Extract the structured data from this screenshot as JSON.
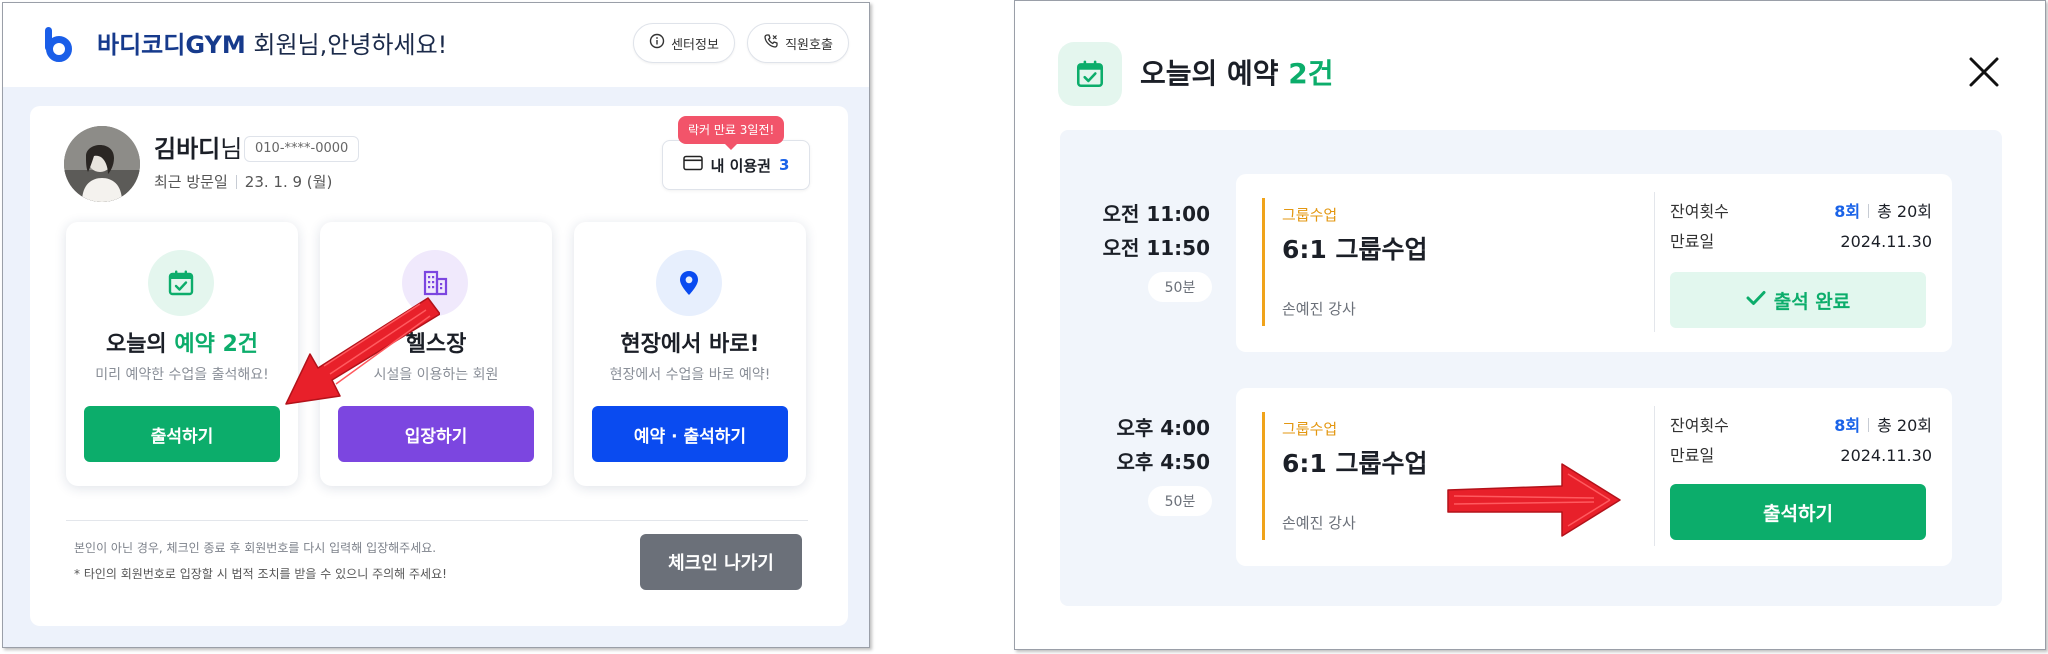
{
  "left": {
    "header": {
      "brand": "바디코디GYM",
      "greeting": " 회원님,안녕하세요!",
      "center_info_label": "센터정보",
      "staff_call_label": "직원호출"
    },
    "member": {
      "name": "김바디",
      "name_suffix": "님",
      "phone": "010-****-0000",
      "last_visit_label": "최근 방문일",
      "last_visit_value": "23. 1. 9 (월)"
    },
    "pass": {
      "badge": "락커 만료 3일전!",
      "label": "내 이용권",
      "count": "3"
    },
    "cards": [
      {
        "title_a": "오늘의 ",
        "title_b": "예약 2건",
        "desc": "미리 예약한 수업을 출석해요!",
        "button": "출석하기",
        "icon": "calendar-check-icon",
        "color": "#0cad6b"
      },
      {
        "title": "헬스장",
        "desc": "시설을 이용하는 회원",
        "button": "입장하기",
        "icon": "building-icon",
        "color": "#7c46e0"
      },
      {
        "title": "현장에서 바로!",
        "desc": "현장에서 수업을 바로 예약!",
        "button": "예약 · 출석하기",
        "icon": "map-pin-icon",
        "color": "#0a4bf0"
      }
    ],
    "notice_1": "본인이 아닌 경우, 체크인 종료 후 회원번호를 다시 입력해 입장해주세요.",
    "notice_2": "* 타인의 회원번호로 입장할 시 법적 조치를 받을 수 있으니 주의해 주세요!",
    "checkout_label": "체크인 나가기"
  },
  "right": {
    "title_a": "오늘의 예약 ",
    "title_b": "2건",
    "reservations": [
      {
        "start": "오전 11:00",
        "end": "오전 11:50",
        "duration": "50분",
        "category": "그룹수업",
        "name": "6:1 그룹수업",
        "coach": "손예진 강사",
        "remain_label": "잔여횟수",
        "remain": "8회",
        "total": "총 20회",
        "expire_label": "만료일",
        "expire": "2024.11.30",
        "button": "출석 완료",
        "status": "attended"
      },
      {
        "start": "오후 4:00",
        "end": "오후 4:50",
        "duration": "50분",
        "category": "그룹수업",
        "name": "6:1 그룹수업",
        "coach": "손예진 강사",
        "remain_label": "잔여횟수",
        "remain": "8회",
        "total": "총 20회",
        "expire_label": "만료일",
        "expire": "2024.11.30",
        "button": "출석하기",
        "status": "pending"
      }
    ]
  },
  "colors": {
    "accent_green": "#0cad6b",
    "accent_purple": "#7c46e0",
    "accent_blue": "#0a4bf0",
    "badge_red": "#f2546a",
    "annotation_arrow": "#e8202a"
  }
}
